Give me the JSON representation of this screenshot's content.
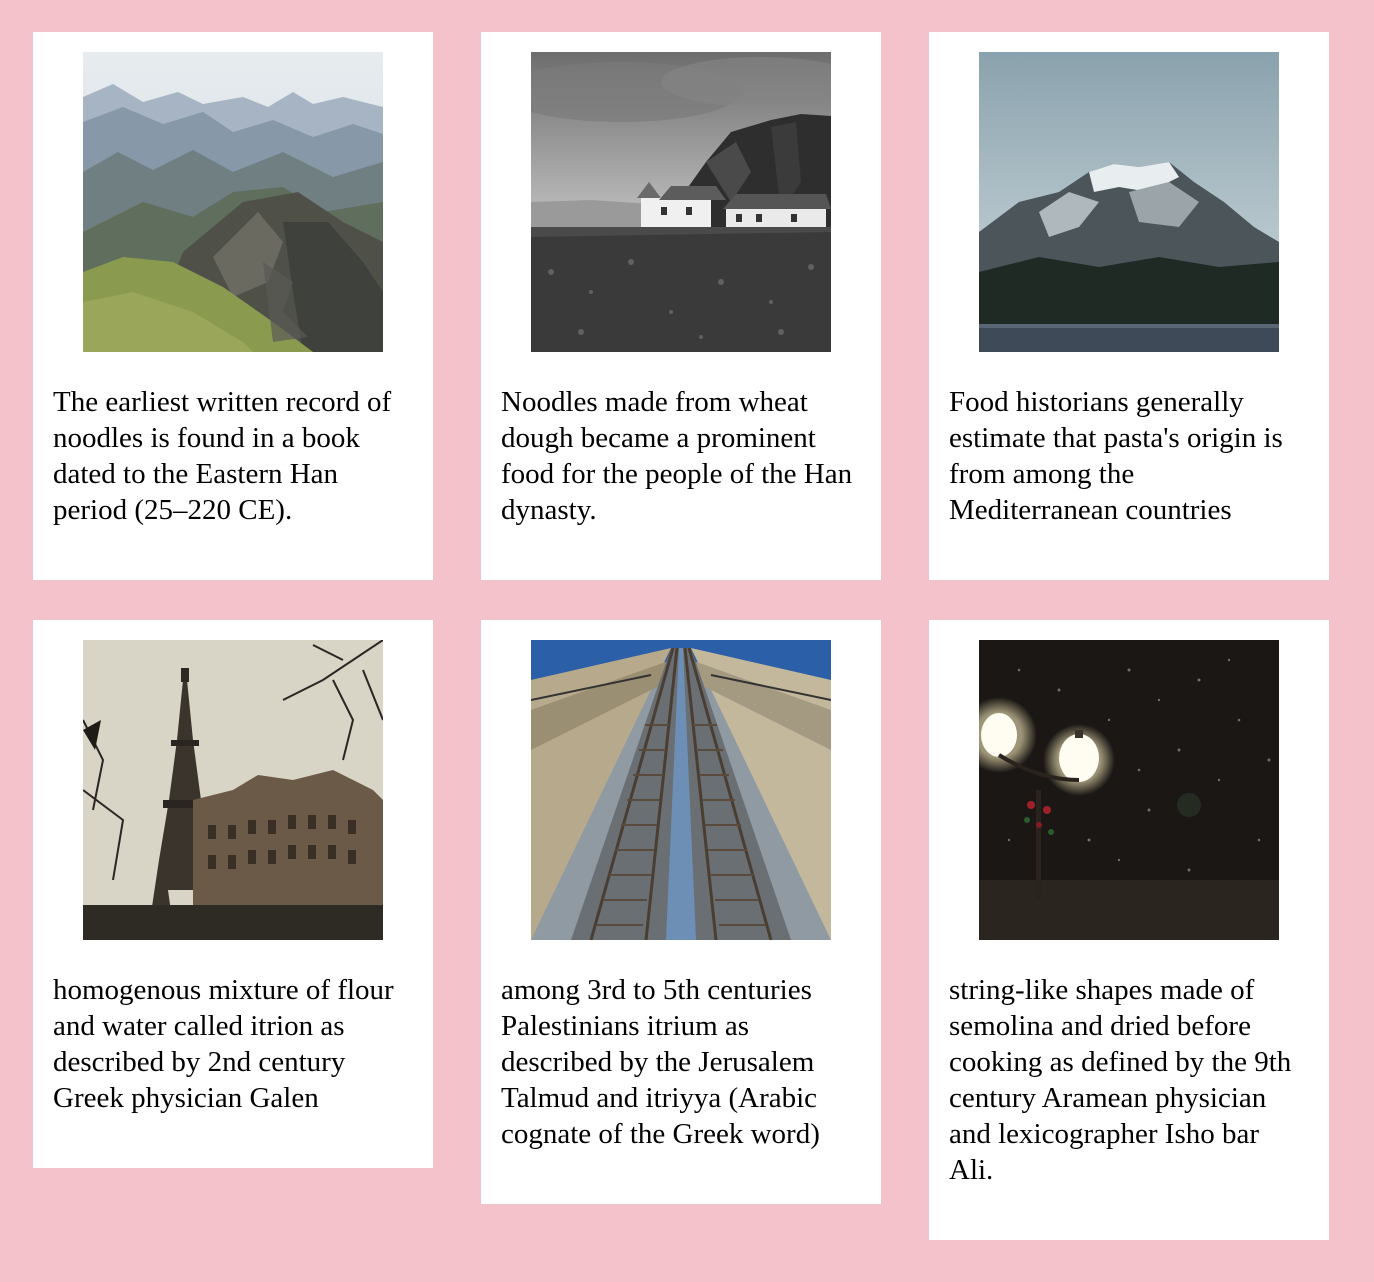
{
  "cards": [
    {
      "image": "mountain-range-icon",
      "caption": "The earliest written record of noodles is found in a book dated to the Eastern Han period (25–220 CE)."
    },
    {
      "image": "cliff-cottage-icon",
      "caption": "Noodles made from wheat dough became a prominent food for the people of the Han dynasty."
    },
    {
      "image": "snowy-peak-icon",
      "caption": "Food historians generally estimate that pasta's origin is from among the Mediterranean countries"
    },
    {
      "image": "eiffel-tower-icon",
      "caption": "homogenous mixture of flour and water called itrion as described by 2nd century Greek physician Galen"
    },
    {
      "image": "railway-tracks-icon",
      "caption": "among 3rd to 5th centuries Palestinians itrium as described by the Jerusalem Talmud and itriyya (Arabic cognate of the Greek word)"
    },
    {
      "image": "street-lamps-snow-icon",
      "caption": "string-like shapes made of semolina and dried before cooking as defined by the 9th century Aramean physician and lexicographer Isho bar Ali."
    }
  ],
  "colors": {
    "background": "#f4c2cb",
    "card": "#ffffff",
    "text": "#000000"
  }
}
